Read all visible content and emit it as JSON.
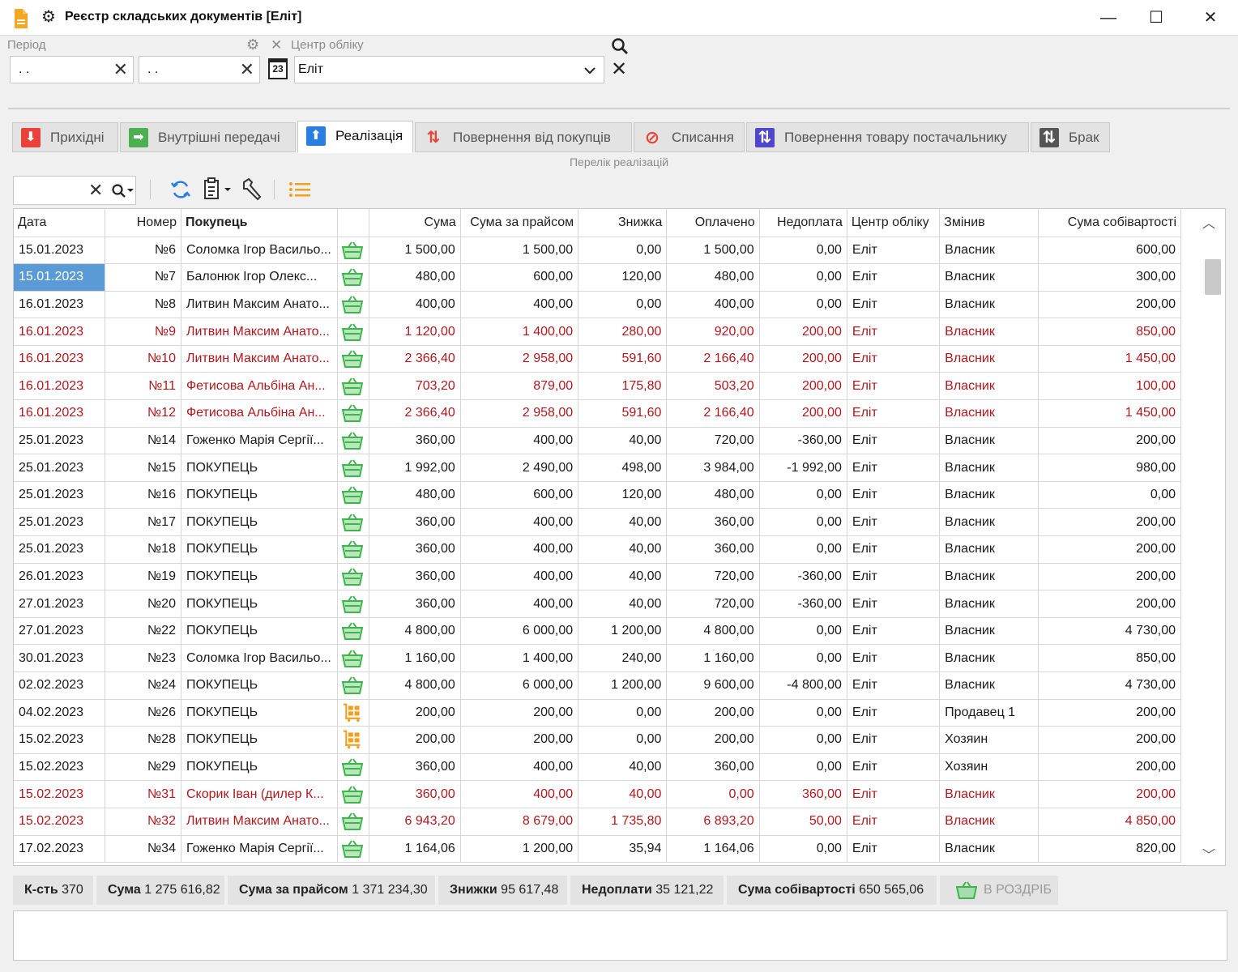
{
  "window": {
    "title": "Реєстр складських документів [Еліт]",
    "minimize": "—",
    "maximize": "☐",
    "close": "✕"
  },
  "filters": {
    "period_label": "Період",
    "date_from": ". .",
    "date_to": ". .",
    "calendar_day": "23",
    "center_label": "Центр обліку",
    "center_value": "Еліт"
  },
  "tabs": [
    {
      "label": "Прихідні",
      "icon": "arrow-down-icon",
      "color": "#e8423b"
    },
    {
      "label": "Внутрішні передачі",
      "icon": "arrow-right-icon",
      "color": "#4caf50"
    },
    {
      "label": "Реалізація",
      "icon": "arrow-up-icon",
      "color": "#2a7de1"
    },
    {
      "label": "Повернення від покупців",
      "icon": "arrows-updown-icon",
      "color": "#e8423b"
    },
    {
      "label": "Списання",
      "icon": "forbidden-icon",
      "color": "#e8423b"
    },
    {
      "label": "Повернення товару постачальнику",
      "icon": "arrows-updown-icon",
      "color": "#5046c8"
    },
    {
      "label": "Брак",
      "icon": "arrows-updown-icon",
      "color": "#555555"
    }
  ],
  "active_tab": "Реалізація",
  "subtitle": "Перелік реалізацій",
  "table": {
    "columns": [
      "Дата",
      "Номер",
      "Покупець",
      "",
      "Сума",
      "Сума за прайсом",
      "Знижка",
      "Оплачено",
      "Недоплата",
      "Центр обліку",
      "Змінив",
      "Сума собівартості"
    ],
    "rows": [
      {
        "date": "15.01.2023",
        "num": "№6",
        "buyer": "Соломка Ігор Васильо...",
        "kind": "basket",
        "sum": "1 500,00",
        "price": "1 500,00",
        "disc": "0,00",
        "paid": "1 500,00",
        "debt": "0,00",
        "center": "Еліт",
        "user": "Власник",
        "cost": "600,00",
        "red": false
      },
      {
        "date": "15.01.2023",
        "num": "№7",
        "buyer": "Балонюк Ігор Олекс...",
        "kind": "basket",
        "sum": "480,00",
        "price": "600,00",
        "disc": "120,00",
        "paid": "480,00",
        "debt": "0,00",
        "center": "Еліт",
        "user": "Власник",
        "cost": "300,00",
        "red": false
      },
      {
        "date": "16.01.2023",
        "num": "№8",
        "buyer": "Литвин Максим Анато...",
        "kind": "basket",
        "sum": "400,00",
        "price": "400,00",
        "disc": "0,00",
        "paid": "400,00",
        "debt": "0,00",
        "center": "Еліт",
        "user": "Власник",
        "cost": "200,00",
        "red": false
      },
      {
        "date": "16.01.2023",
        "num": "№9",
        "buyer": "Литвин Максим Анато...",
        "kind": "basket",
        "sum": "1 120,00",
        "price": "1 400,00",
        "disc": "280,00",
        "paid": "920,00",
        "debt": "200,00",
        "center": "Еліт",
        "user": "Власник",
        "cost": "850,00",
        "red": true
      },
      {
        "date": "16.01.2023",
        "num": "№10",
        "buyer": "Литвин Максим Анато...",
        "kind": "basket",
        "sum": "2 366,40",
        "price": "2 958,00",
        "disc": "591,60",
        "paid": "2 166,40",
        "debt": "200,00",
        "center": "Еліт",
        "user": "Власник",
        "cost": "1 450,00",
        "red": true
      },
      {
        "date": "16.01.2023",
        "num": "№11",
        "buyer": "Фетисова Альбіна Ан...",
        "kind": "basket",
        "sum": "703,20",
        "price": "879,00",
        "disc": "175,80",
        "paid": "503,20",
        "debt": "200,00",
        "center": "Еліт",
        "user": "Власник",
        "cost": "100,00",
        "red": true
      },
      {
        "date": "16.01.2023",
        "num": "№12",
        "buyer": "Фетисова Альбіна Ан...",
        "kind": "basket",
        "sum": "2 366,40",
        "price": "2 958,00",
        "disc": "591,60",
        "paid": "2 166,40",
        "debt": "200,00",
        "center": "Еліт",
        "user": "Власник",
        "cost": "1 450,00",
        "red": true
      },
      {
        "date": "25.01.2023",
        "num": "№14",
        "buyer": "Гоженко Марія Сергії...",
        "kind": "basket",
        "sum": "360,00",
        "price": "400,00",
        "disc": "40,00",
        "paid": "720,00",
        "debt": "-360,00",
        "center": "Еліт",
        "user": "Власник",
        "cost": "200,00",
        "red": false
      },
      {
        "date": "25.01.2023",
        "num": "№15",
        "buyer": "ПОКУПЕЦЬ",
        "kind": "basket",
        "sum": "1 992,00",
        "price": "2 490,00",
        "disc": "498,00",
        "paid": "3 984,00",
        "debt": "-1 992,00",
        "center": "Еліт",
        "user": "Власник",
        "cost": "980,00",
        "red": false
      },
      {
        "date": "25.01.2023",
        "num": "№16",
        "buyer": "ПОКУПЕЦЬ",
        "kind": "basket",
        "sum": "480,00",
        "price": "600,00",
        "disc": "120,00",
        "paid": "480,00",
        "debt": "0,00",
        "center": "Еліт",
        "user": "Власник",
        "cost": "0,00",
        "red": false
      },
      {
        "date": "25.01.2023",
        "num": "№17",
        "buyer": "ПОКУПЕЦЬ",
        "kind": "basket",
        "sum": "360,00",
        "price": "400,00",
        "disc": "40,00",
        "paid": "360,00",
        "debt": "0,00",
        "center": "Еліт",
        "user": "Власник",
        "cost": "200,00",
        "red": false
      },
      {
        "date": "25.01.2023",
        "num": "№18",
        "buyer": "ПОКУПЕЦЬ",
        "kind": "basket",
        "sum": "360,00",
        "price": "400,00",
        "disc": "40,00",
        "paid": "360,00",
        "debt": "0,00",
        "center": "Еліт",
        "user": "Власник",
        "cost": "200,00",
        "red": false
      },
      {
        "date": "26.01.2023",
        "num": "№19",
        "buyer": "ПОКУПЕЦЬ",
        "kind": "basket",
        "sum": "360,00",
        "price": "400,00",
        "disc": "40,00",
        "paid": "720,00",
        "debt": "-360,00",
        "center": "Еліт",
        "user": "Власник",
        "cost": "200,00",
        "red": false
      },
      {
        "date": "27.01.2023",
        "num": "№20",
        "buyer": "ПОКУПЕЦЬ",
        "kind": "basket",
        "sum": "360,00",
        "price": "400,00",
        "disc": "40,00",
        "paid": "720,00",
        "debt": "-360,00",
        "center": "Еліт",
        "user": "Власник",
        "cost": "200,00",
        "red": false
      },
      {
        "date": "27.01.2023",
        "num": "№22",
        "buyer": "ПОКУПЕЦЬ",
        "kind": "basket",
        "sum": "4 800,00",
        "price": "6 000,00",
        "disc": "1 200,00",
        "paid": "4 800,00",
        "debt": "0,00",
        "center": "Еліт",
        "user": "Власник",
        "cost": "4 730,00",
        "red": false
      },
      {
        "date": "30.01.2023",
        "num": "№23",
        "buyer": "Соломка Ігор Васильо...",
        "kind": "basket",
        "sum": "1 160,00",
        "price": "1 400,00",
        "disc": "240,00",
        "paid": "1 160,00",
        "debt": "0,00",
        "center": "Еліт",
        "user": "Власник",
        "cost": "850,00",
        "red": false
      },
      {
        "date": "02.02.2023",
        "num": "№24",
        "buyer": "ПОКУПЕЦЬ",
        "kind": "basket",
        "sum": "4 800,00",
        "price": "6 000,00",
        "disc": "1 200,00",
        "paid": "9 600,00",
        "debt": "-4 800,00",
        "center": "Еліт",
        "user": "Власник",
        "cost": "4 730,00",
        "red": false
      },
      {
        "date": "04.02.2023",
        "num": "№26",
        "buyer": "ПОКУПЕЦЬ",
        "kind": "cart",
        "sum": "200,00",
        "price": "200,00",
        "disc": "0,00",
        "paid": "200,00",
        "debt": "0,00",
        "center": "Еліт",
        "user": "Продавец 1",
        "cost": "200,00",
        "red": false
      },
      {
        "date": "15.02.2023",
        "num": "№28",
        "buyer": "ПОКУПЕЦЬ",
        "kind": "cart",
        "sum": "200,00",
        "price": "200,00",
        "disc": "0,00",
        "paid": "200,00",
        "debt": "0,00",
        "center": "Еліт",
        "user": "Хозяин",
        "cost": "200,00",
        "red": false
      },
      {
        "date": "15.02.2023",
        "num": "№29",
        "buyer": "ПОКУПЕЦЬ",
        "kind": "basket",
        "sum": "360,00",
        "price": "400,00",
        "disc": "40,00",
        "paid": "360,00",
        "debt": "0,00",
        "center": "Еліт",
        "user": "Хозяин",
        "cost": "200,00",
        "red": false
      },
      {
        "date": "15.02.2023",
        "num": "№31",
        "buyer": "Скорик Іван (дилер К...",
        "kind": "basket",
        "sum": "360,00",
        "price": "400,00",
        "disc": "40,00",
        "paid": "0,00",
        "debt": "360,00",
        "center": "Еліт",
        "user": "Власник",
        "cost": "200,00",
        "red": true
      },
      {
        "date": "15.02.2023",
        "num": "№32",
        "buyer": "Литвин Максим Анато...",
        "kind": "basket",
        "sum": "6 943,20",
        "price": "8 679,00",
        "disc": "1 735,80",
        "paid": "6 893,20",
        "debt": "50,00",
        "center": "Еліт",
        "user": "Власник",
        "cost": "4 850,00",
        "red": true
      },
      {
        "date": "17.02.2023",
        "num": "№34",
        "buyer": "Гоженко Марія Сергії...",
        "kind": "basket",
        "sum": "1 164,06",
        "price": "1 200,00",
        "disc": "35,94",
        "paid": "1 164,06",
        "debt": "0,00",
        "center": "Еліт",
        "user": "Власник",
        "cost": "820,00",
        "red": false
      }
    ]
  },
  "summary": {
    "count_label": "К-сть",
    "count": "370",
    "sum_label": "Сума",
    "sum": "1 275 616,82",
    "price_label": "Сума за прайсом",
    "price": "1 371 234,30",
    "disc_label": "Знижки",
    "disc": "95 617,48",
    "debt_label": "Недоплати",
    "debt": "35 121,22",
    "cost_label": "Сума собівартості",
    "cost": "650 565,06",
    "retail_label": "В РОЗДРІБ"
  },
  "colors": {
    "accent": "#5b9bd5",
    "red_row": "#b3171b",
    "basket": "#3cb54a",
    "cart": "#f0a020"
  }
}
